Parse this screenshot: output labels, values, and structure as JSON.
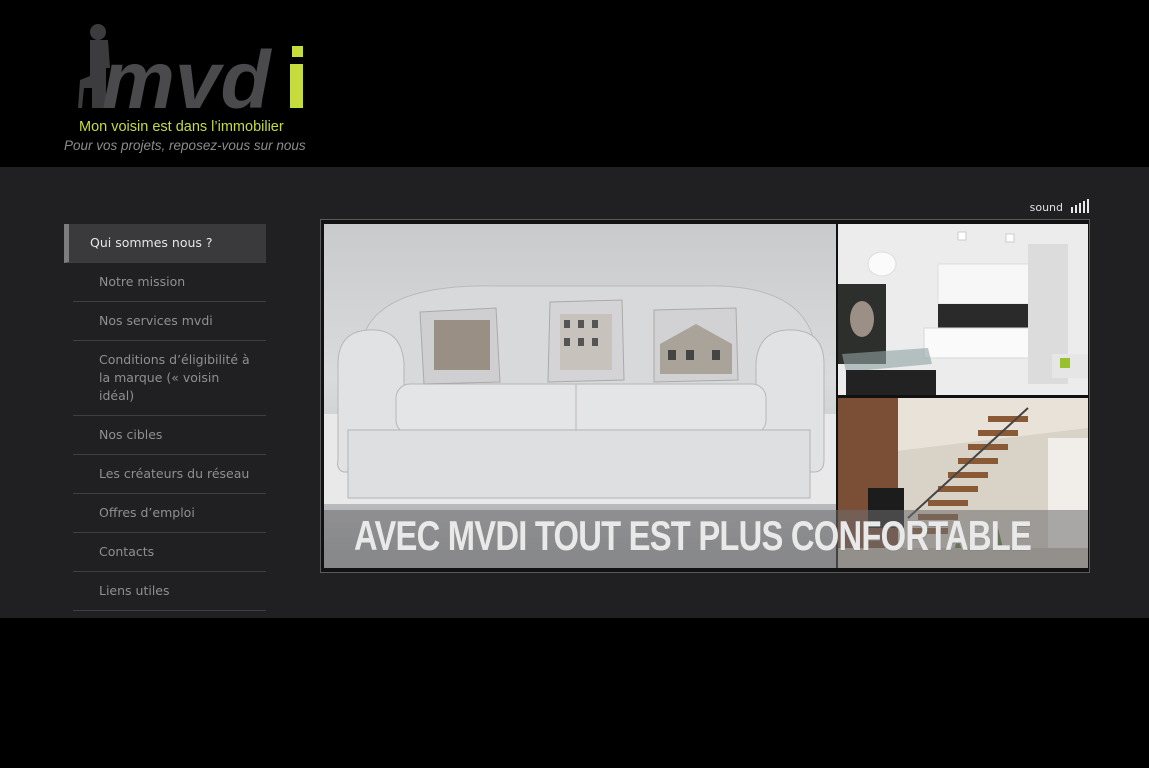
{
  "logo": {
    "wordmark": "mvdi",
    "tagline": "Mon voisin est dans l’immobilier",
    "subtitle": "Pour vos projets, reposez-vous sur nous",
    "accent_color": "#c6dc3c"
  },
  "nav": {
    "items": [
      {
        "label": "Qui sommes nous ?",
        "active": true
      },
      {
        "label": "Notre mission"
      },
      {
        "label": "Nos services mvdi"
      },
      {
        "label": "Conditions d’éligibilité à la marque (« voisin idéal)"
      },
      {
        "label": "Nos cibles"
      },
      {
        "label": "Les créateurs du réseau"
      },
      {
        "label": "Offres d’emploi"
      },
      {
        "label": "Contacts"
      },
      {
        "label": "Liens utiles"
      }
    ]
  },
  "sound": {
    "label": "sound",
    "icon": "volume-bars-icon"
  },
  "banner": {
    "slogan": "AVEC MVDI TOUT EST PLUS CONFORTABLE",
    "images": [
      "sofa-with-house-cushions",
      "modern-kitchen",
      "modern-staircase"
    ]
  }
}
